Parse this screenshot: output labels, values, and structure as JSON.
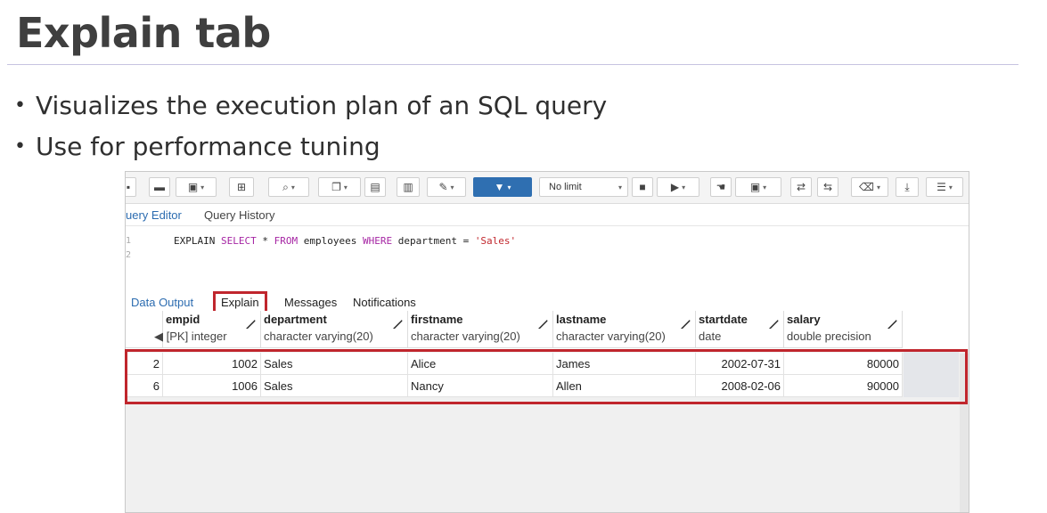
{
  "slide": {
    "title": "Explain tab",
    "bullets": [
      "Visualizes the execution plan of an SQL query",
      "Use for performance tuning"
    ]
  },
  "toolbar": {
    "limit_label": "No limit",
    "icons": [
      "save-icon",
      "folder-icon",
      "disk-icon",
      "chevron-down-icon",
      "grid-icon",
      "search-icon",
      "chevron-down-icon",
      "copy-icon",
      "chevron-down-icon",
      "paste-icon",
      "trash-icon",
      "edit-icon",
      "filter-icon",
      "stop-icon",
      "play-icon",
      "hand-icon",
      "explain-icon",
      "commit-icon",
      "rollback-icon",
      "eraser-icon",
      "download-icon",
      "macro-icon"
    ]
  },
  "editor": {
    "tabs": [
      "uery Editor",
      "Query History"
    ],
    "active_tab": "uery Editor",
    "line_numbers": [
      "1",
      "2"
    ],
    "code": {
      "kw_explain": "EXPLAIN",
      "kw_select": "SELECT",
      "star": " * ",
      "kw_from": "FROM",
      "table": " employees ",
      "kw_where": "WHERE",
      "cond": " department = ",
      "literal": "'Sales'"
    }
  },
  "results": {
    "tabs": [
      "Data Output",
      "Explain",
      "Messages",
      "Notifications"
    ],
    "active_tab": "Data Output",
    "highlighted_tab": "Explain",
    "columns": [
      {
        "name": "empid",
        "type": "[PK] integer"
      },
      {
        "name": "department",
        "type": "character varying(20)"
      },
      {
        "name": "firstname",
        "type": "character varying(20)"
      },
      {
        "name": "lastname",
        "type": "character varying(20)"
      },
      {
        "name": "startdate",
        "type": "date"
      },
      {
        "name": "salary",
        "type": "double precision"
      }
    ],
    "rows": [
      {
        "rownum": "2",
        "empid": "1002",
        "department": "Sales",
        "firstname": "Alice",
        "lastname": "James",
        "startdate": "2002-07-31",
        "salary": "80000"
      },
      {
        "rownum": "6",
        "empid": "1006",
        "department": "Sales",
        "firstname": "Nancy",
        "lastname": "Allen",
        "startdate": "2008-02-06",
        "salary": "90000"
      }
    ]
  },
  "colors": {
    "accent": "#2f6fb1",
    "highlight": "#c0262d",
    "keyword": "#a626a4",
    "string": "#c1272d"
  }
}
